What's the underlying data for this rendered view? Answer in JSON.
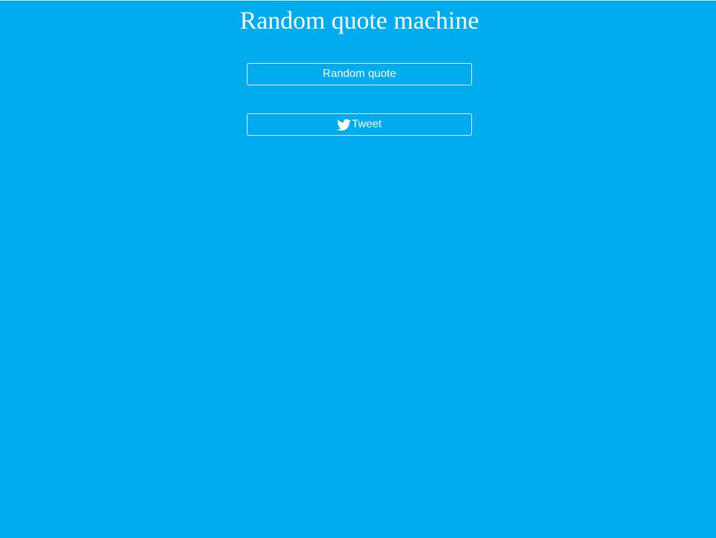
{
  "page": {
    "title": "Random quote machine"
  },
  "buttons": {
    "random_quote_label": "Random quote",
    "tweet_label": "Tweet"
  },
  "icons": {
    "tweet_icon": "twitter-bird-icon"
  },
  "colors": {
    "background": "#00acee",
    "text": "#ffffff",
    "button_border": "#ffffff"
  }
}
